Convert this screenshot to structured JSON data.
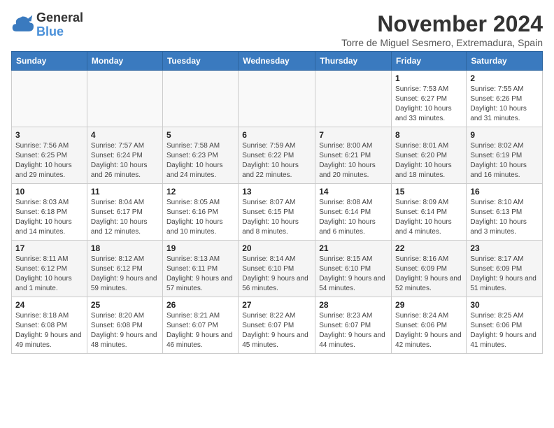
{
  "logo": {
    "line1": "General",
    "line2": "Blue"
  },
  "header": {
    "month": "November 2024",
    "location": "Torre de Miguel Sesmero, Extremadura, Spain"
  },
  "days_of_week": [
    "Sunday",
    "Monday",
    "Tuesday",
    "Wednesday",
    "Thursday",
    "Friday",
    "Saturday"
  ],
  "weeks": [
    [
      {
        "day": "",
        "info": ""
      },
      {
        "day": "",
        "info": ""
      },
      {
        "day": "",
        "info": ""
      },
      {
        "day": "",
        "info": ""
      },
      {
        "day": "",
        "info": ""
      },
      {
        "day": "1",
        "info": "Sunrise: 7:53 AM\nSunset: 6:27 PM\nDaylight: 10 hours and 33 minutes."
      },
      {
        "day": "2",
        "info": "Sunrise: 7:55 AM\nSunset: 6:26 PM\nDaylight: 10 hours and 31 minutes."
      }
    ],
    [
      {
        "day": "3",
        "info": "Sunrise: 7:56 AM\nSunset: 6:25 PM\nDaylight: 10 hours and 29 minutes."
      },
      {
        "day": "4",
        "info": "Sunrise: 7:57 AM\nSunset: 6:24 PM\nDaylight: 10 hours and 26 minutes."
      },
      {
        "day": "5",
        "info": "Sunrise: 7:58 AM\nSunset: 6:23 PM\nDaylight: 10 hours and 24 minutes."
      },
      {
        "day": "6",
        "info": "Sunrise: 7:59 AM\nSunset: 6:22 PM\nDaylight: 10 hours and 22 minutes."
      },
      {
        "day": "7",
        "info": "Sunrise: 8:00 AM\nSunset: 6:21 PM\nDaylight: 10 hours and 20 minutes."
      },
      {
        "day": "8",
        "info": "Sunrise: 8:01 AM\nSunset: 6:20 PM\nDaylight: 10 hours and 18 minutes."
      },
      {
        "day": "9",
        "info": "Sunrise: 8:02 AM\nSunset: 6:19 PM\nDaylight: 10 hours and 16 minutes."
      }
    ],
    [
      {
        "day": "10",
        "info": "Sunrise: 8:03 AM\nSunset: 6:18 PM\nDaylight: 10 hours and 14 minutes."
      },
      {
        "day": "11",
        "info": "Sunrise: 8:04 AM\nSunset: 6:17 PM\nDaylight: 10 hours and 12 minutes."
      },
      {
        "day": "12",
        "info": "Sunrise: 8:05 AM\nSunset: 6:16 PM\nDaylight: 10 hours and 10 minutes."
      },
      {
        "day": "13",
        "info": "Sunrise: 8:07 AM\nSunset: 6:15 PM\nDaylight: 10 hours and 8 minutes."
      },
      {
        "day": "14",
        "info": "Sunrise: 8:08 AM\nSunset: 6:14 PM\nDaylight: 10 hours and 6 minutes."
      },
      {
        "day": "15",
        "info": "Sunrise: 8:09 AM\nSunset: 6:14 PM\nDaylight: 10 hours and 4 minutes."
      },
      {
        "day": "16",
        "info": "Sunrise: 8:10 AM\nSunset: 6:13 PM\nDaylight: 10 hours and 3 minutes."
      }
    ],
    [
      {
        "day": "17",
        "info": "Sunrise: 8:11 AM\nSunset: 6:12 PM\nDaylight: 10 hours and 1 minute."
      },
      {
        "day": "18",
        "info": "Sunrise: 8:12 AM\nSunset: 6:12 PM\nDaylight: 9 hours and 59 minutes."
      },
      {
        "day": "19",
        "info": "Sunrise: 8:13 AM\nSunset: 6:11 PM\nDaylight: 9 hours and 57 minutes."
      },
      {
        "day": "20",
        "info": "Sunrise: 8:14 AM\nSunset: 6:10 PM\nDaylight: 9 hours and 56 minutes."
      },
      {
        "day": "21",
        "info": "Sunrise: 8:15 AM\nSunset: 6:10 PM\nDaylight: 9 hours and 54 minutes."
      },
      {
        "day": "22",
        "info": "Sunrise: 8:16 AM\nSunset: 6:09 PM\nDaylight: 9 hours and 52 minutes."
      },
      {
        "day": "23",
        "info": "Sunrise: 8:17 AM\nSunset: 6:09 PM\nDaylight: 9 hours and 51 minutes."
      }
    ],
    [
      {
        "day": "24",
        "info": "Sunrise: 8:18 AM\nSunset: 6:08 PM\nDaylight: 9 hours and 49 minutes."
      },
      {
        "day": "25",
        "info": "Sunrise: 8:20 AM\nSunset: 6:08 PM\nDaylight: 9 hours and 48 minutes."
      },
      {
        "day": "26",
        "info": "Sunrise: 8:21 AM\nSunset: 6:07 PM\nDaylight: 9 hours and 46 minutes."
      },
      {
        "day": "27",
        "info": "Sunrise: 8:22 AM\nSunset: 6:07 PM\nDaylight: 9 hours and 45 minutes."
      },
      {
        "day": "28",
        "info": "Sunrise: 8:23 AM\nSunset: 6:07 PM\nDaylight: 9 hours and 44 minutes."
      },
      {
        "day": "29",
        "info": "Sunrise: 8:24 AM\nSunset: 6:06 PM\nDaylight: 9 hours and 42 minutes."
      },
      {
        "day": "30",
        "info": "Sunrise: 8:25 AM\nSunset: 6:06 PM\nDaylight: 9 hours and 41 minutes."
      }
    ]
  ]
}
